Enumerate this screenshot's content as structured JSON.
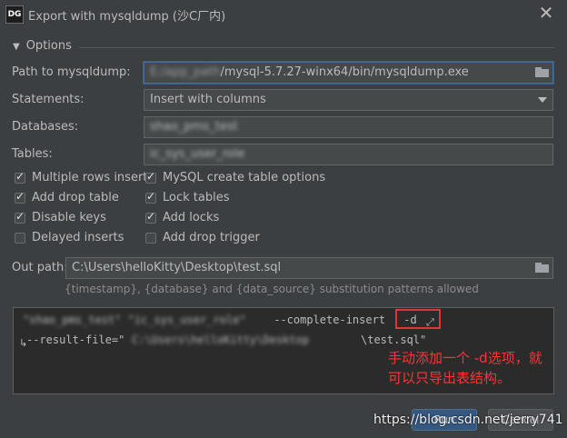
{
  "window": {
    "app_icon_text": "DG",
    "title": "Export with mysqldump (沙C厂内)",
    "close_icon": "close-icon"
  },
  "options": {
    "section_label": "Options",
    "path_label": "Path to mysqldump:",
    "path_value_hidden": "E:/app_path",
    "path_value": "/mysql-5.7.27-winx64/bin/mysqldump.exe",
    "statements_label": "Statements:",
    "statements_value": "Insert with columns",
    "databases_label": "Databases:",
    "databases_value": "shao_pms_test",
    "tables_label": "Tables:",
    "tables_value": "ic_sys_user_role"
  },
  "checkboxes": [
    {
      "label": "Multiple rows inserts",
      "checked": true
    },
    {
      "label": "MySQL create table options",
      "checked": true
    },
    {
      "label": "Add drop table",
      "checked": true
    },
    {
      "label": "Lock tables",
      "checked": true
    },
    {
      "label": "Disable keys",
      "checked": true
    },
    {
      "label": "Add locks",
      "checked": true
    },
    {
      "label": "Delayed inserts",
      "checked": false
    },
    {
      "label": "Add drop trigger",
      "checked": false
    }
  ],
  "output": {
    "out_path_label": "Out path:",
    "out_path_value": "C:\\Users\\helloKitty\\Desktop\\test.sql",
    "hint": "{timestamp}, {database} and {data_source} substitution patterns allowed"
  },
  "command": {
    "line1_blurred": "\"shao_pms_test\" \"ic_sys_user_role\"",
    "line1_flag": " --complete-insert",
    "line1_added": " -d",
    "line2_prefix": "--result-file=\"",
    "line2_blurred": "C:\\Users\\helloKitty\\Desktop",
    "line2_suffix": "\\test.sql\""
  },
  "annotation": {
    "line1": "手动添加一个 -d选项，就",
    "line2": "可以只导出表结构。"
  },
  "buttons": {
    "run": "Run",
    "cancel": "Cancel"
  },
  "watermark": "https://blog.csdn.net/jerry741"
}
